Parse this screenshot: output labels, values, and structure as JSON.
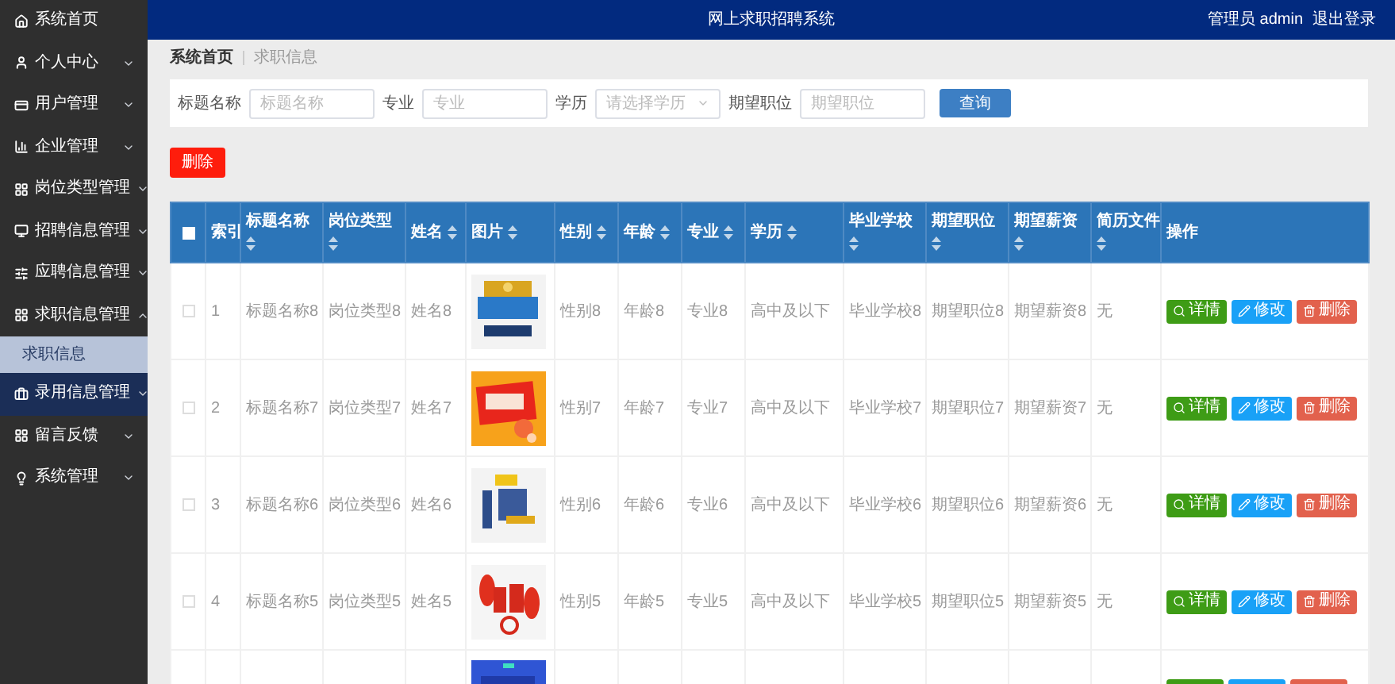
{
  "sidebar": {
    "items": [
      {
        "label": "系统首页",
        "expandable": false,
        "highlighted": false
      },
      {
        "label": "个人中心",
        "expandable": true,
        "expanded": false,
        "highlighted": false
      },
      {
        "label": "用户管理",
        "expandable": true,
        "expanded": false,
        "highlighted": false
      },
      {
        "label": "企业管理",
        "expandable": true,
        "expanded": false,
        "highlighted": false
      },
      {
        "label": "岗位类型管理",
        "expandable": true,
        "expanded": false,
        "highlighted": false
      },
      {
        "label": "招聘信息管理",
        "expandable": true,
        "expanded": false,
        "highlighted": false
      },
      {
        "label": "应聘信息管理",
        "expandable": true,
        "expanded": false,
        "highlighted": false
      },
      {
        "label": "求职信息管理",
        "expandable": true,
        "expanded": true,
        "highlighted": false,
        "children": [
          {
            "label": "求职信息",
            "selected": true
          }
        ]
      },
      {
        "label": "录用信息管理",
        "expandable": true,
        "expanded": false,
        "highlighted": true
      },
      {
        "label": "留言反馈",
        "expandable": true,
        "expanded": false,
        "highlighted": false
      },
      {
        "label": "系统管理",
        "expandable": true,
        "expanded": false,
        "highlighted": false
      }
    ]
  },
  "header": {
    "title": "网上求职招聘系统",
    "user": "管理员 admin",
    "logout": "退出登录"
  },
  "breadcrumb": [
    "系统首页",
    "求职信息"
  ],
  "search": {
    "fields": [
      {
        "label": "标题名称",
        "kind": "input",
        "placeholder": "标题名称"
      },
      {
        "label": "专业",
        "kind": "input",
        "placeholder": "专业"
      },
      {
        "label": "学历",
        "kind": "select",
        "placeholder": "请选择学历"
      },
      {
        "label": "期望职位",
        "kind": "input",
        "placeholder": "期望职位"
      }
    ],
    "button": "查询"
  },
  "delete_button": "删除",
  "table": {
    "select_all_checked": false,
    "columns": [
      {
        "label": "索引",
        "sortable": false
      },
      {
        "label": "标题名称",
        "sortable": true
      },
      {
        "label": "岗位类型",
        "sortable": true
      },
      {
        "label": "姓名",
        "sortable": true
      },
      {
        "label": "图片",
        "sortable": true
      },
      {
        "label": "性别",
        "sortable": true
      },
      {
        "label": "年龄",
        "sortable": true
      },
      {
        "label": "专业",
        "sortable": true
      },
      {
        "label": "学历",
        "sortable": true
      },
      {
        "label": "毕业学校",
        "sortable": true
      },
      {
        "label": "期望职位",
        "sortable": true
      },
      {
        "label": "期望薪资",
        "sortable": true
      },
      {
        "label": "简历文件",
        "sortable": true
      },
      {
        "label": "操作",
        "sortable": false
      }
    ],
    "rows": [
      {
        "kind": "full",
        "checked": false,
        "cells": [
          "1",
          "标题名称8",
          "岗位类型8",
          "姓名8",
          "性别8",
          "年龄8",
          "专业8",
          "高中及以下",
          "毕业学校8",
          "期望职位8",
          "期望薪资8",
          "无"
        ],
        "actions": [
          "详情",
          "修改",
          "删除"
        ]
      },
      {
        "kind": "full",
        "checked": false,
        "cells": [
          "2",
          "标题名称7",
          "岗位类型7",
          "姓名7",
          "性别7",
          "年龄7",
          "专业7",
          "高中及以下",
          "毕业学校7",
          "期望职位7",
          "期望薪资7",
          "无"
        ],
        "actions": [
          "详情",
          "修改",
          "删除"
        ]
      },
      {
        "kind": "full",
        "checked": false,
        "cells": [
          "3",
          "标题名称6",
          "岗位类型6",
          "姓名6",
          "性别6",
          "年龄6",
          "专业6",
          "高中及以下",
          "毕业学校6",
          "期望职位6",
          "期望薪资6",
          "无"
        ],
        "actions": [
          "详情",
          "修改",
          "删除"
        ]
      },
      {
        "kind": "full",
        "checked": false,
        "cells": [
          "4",
          "标题名称5",
          "岗位类型5",
          "姓名5",
          "性别5",
          "年龄5",
          "专业5",
          "高中及以下",
          "毕业学校5",
          "期望职位5",
          "期望薪资5",
          "无"
        ],
        "actions": [
          "详情",
          "修改",
          "删除"
        ]
      },
      {
        "kind": "partial"
      }
    ]
  }
}
